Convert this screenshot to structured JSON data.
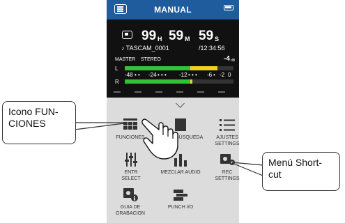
{
  "header": {
    "title": "MANUAL"
  },
  "display": {
    "time_h": "99",
    "unit_h": "H",
    "time_m": "59",
    "unit_m": "M",
    "time_s": "59",
    "unit_s": "S",
    "file_name": "♪ TASCAM_0001",
    "remaining": "/12:34:56",
    "mode_master": "MASTER",
    "mode_stereo": "STEREO",
    "level_db": "-4",
    "level_unit": "dB",
    "channel_l": "L",
    "channel_r": "R",
    "scale": [
      "-48",
      "-24",
      "-12",
      "-6",
      "-2",
      "0"
    ],
    "meter_l_level": 0.85,
    "meter_r_level": 0.62
  },
  "menu": {
    "funciones": "FUNCIONES",
    "busqueda": "BÚSQUEDA",
    "ajustes": [
      "AJUSTES",
      "SETTINGS"
    ],
    "entr": [
      "ENTR",
      "SELECT"
    ],
    "mezclar": "MEZCLAR AUDIO",
    "rec": [
      "REC",
      "SETTINGS"
    ],
    "guia": [
      "GUIA DE",
      "GRABACION"
    ],
    "punch": "PUNCH I/O"
  },
  "callouts": {
    "left": [
      "Icono FUN-",
      "CIONES"
    ],
    "right": [
      "Menú Short-",
      "cut"
    ]
  },
  "colors": {
    "header": "#1e5c9e",
    "meter_green": "#2ec43a",
    "meter_yellow": "#f0d020",
    "panel": "#dcdcdc"
  }
}
